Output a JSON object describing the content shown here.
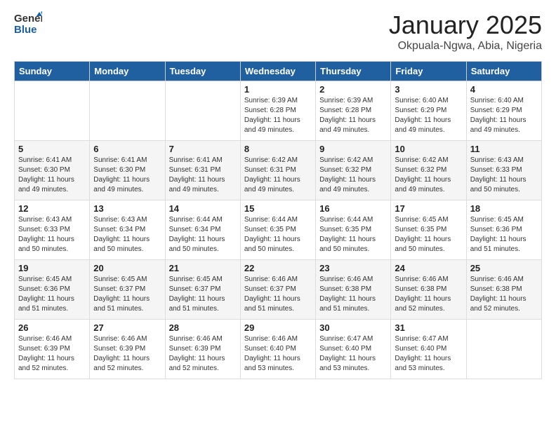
{
  "header": {
    "logo_general": "General",
    "logo_blue": "Blue",
    "month": "January 2025",
    "location": "Okpuala-Ngwa, Abia, Nigeria"
  },
  "weekdays": [
    "Sunday",
    "Monday",
    "Tuesday",
    "Wednesday",
    "Thursday",
    "Friday",
    "Saturday"
  ],
  "weeks": [
    [
      {
        "day": "",
        "info": ""
      },
      {
        "day": "",
        "info": ""
      },
      {
        "day": "",
        "info": ""
      },
      {
        "day": "1",
        "info": "Sunrise: 6:39 AM\nSunset: 6:28 PM\nDaylight: 11 hours and 49 minutes."
      },
      {
        "day": "2",
        "info": "Sunrise: 6:39 AM\nSunset: 6:28 PM\nDaylight: 11 hours and 49 minutes."
      },
      {
        "day": "3",
        "info": "Sunrise: 6:40 AM\nSunset: 6:29 PM\nDaylight: 11 hours and 49 minutes."
      },
      {
        "day": "4",
        "info": "Sunrise: 6:40 AM\nSunset: 6:29 PM\nDaylight: 11 hours and 49 minutes."
      }
    ],
    [
      {
        "day": "5",
        "info": "Sunrise: 6:41 AM\nSunset: 6:30 PM\nDaylight: 11 hours and 49 minutes."
      },
      {
        "day": "6",
        "info": "Sunrise: 6:41 AM\nSunset: 6:30 PM\nDaylight: 11 hours and 49 minutes."
      },
      {
        "day": "7",
        "info": "Sunrise: 6:41 AM\nSunset: 6:31 PM\nDaylight: 11 hours and 49 minutes."
      },
      {
        "day": "8",
        "info": "Sunrise: 6:42 AM\nSunset: 6:31 PM\nDaylight: 11 hours and 49 minutes."
      },
      {
        "day": "9",
        "info": "Sunrise: 6:42 AM\nSunset: 6:32 PM\nDaylight: 11 hours and 49 minutes."
      },
      {
        "day": "10",
        "info": "Sunrise: 6:42 AM\nSunset: 6:32 PM\nDaylight: 11 hours and 49 minutes."
      },
      {
        "day": "11",
        "info": "Sunrise: 6:43 AM\nSunset: 6:33 PM\nDaylight: 11 hours and 50 minutes."
      }
    ],
    [
      {
        "day": "12",
        "info": "Sunrise: 6:43 AM\nSunset: 6:33 PM\nDaylight: 11 hours and 50 minutes."
      },
      {
        "day": "13",
        "info": "Sunrise: 6:43 AM\nSunset: 6:34 PM\nDaylight: 11 hours and 50 minutes."
      },
      {
        "day": "14",
        "info": "Sunrise: 6:44 AM\nSunset: 6:34 PM\nDaylight: 11 hours and 50 minutes."
      },
      {
        "day": "15",
        "info": "Sunrise: 6:44 AM\nSunset: 6:35 PM\nDaylight: 11 hours and 50 minutes."
      },
      {
        "day": "16",
        "info": "Sunrise: 6:44 AM\nSunset: 6:35 PM\nDaylight: 11 hours and 50 minutes."
      },
      {
        "day": "17",
        "info": "Sunrise: 6:45 AM\nSunset: 6:35 PM\nDaylight: 11 hours and 50 minutes."
      },
      {
        "day": "18",
        "info": "Sunrise: 6:45 AM\nSunset: 6:36 PM\nDaylight: 11 hours and 51 minutes."
      }
    ],
    [
      {
        "day": "19",
        "info": "Sunrise: 6:45 AM\nSunset: 6:36 PM\nDaylight: 11 hours and 51 minutes."
      },
      {
        "day": "20",
        "info": "Sunrise: 6:45 AM\nSunset: 6:37 PM\nDaylight: 11 hours and 51 minutes."
      },
      {
        "day": "21",
        "info": "Sunrise: 6:45 AM\nSunset: 6:37 PM\nDaylight: 11 hours and 51 minutes."
      },
      {
        "day": "22",
        "info": "Sunrise: 6:46 AM\nSunset: 6:37 PM\nDaylight: 11 hours and 51 minutes."
      },
      {
        "day": "23",
        "info": "Sunrise: 6:46 AM\nSunset: 6:38 PM\nDaylight: 11 hours and 51 minutes."
      },
      {
        "day": "24",
        "info": "Sunrise: 6:46 AM\nSunset: 6:38 PM\nDaylight: 11 hours and 52 minutes."
      },
      {
        "day": "25",
        "info": "Sunrise: 6:46 AM\nSunset: 6:38 PM\nDaylight: 11 hours and 52 minutes."
      }
    ],
    [
      {
        "day": "26",
        "info": "Sunrise: 6:46 AM\nSunset: 6:39 PM\nDaylight: 11 hours and 52 minutes."
      },
      {
        "day": "27",
        "info": "Sunrise: 6:46 AM\nSunset: 6:39 PM\nDaylight: 11 hours and 52 minutes."
      },
      {
        "day": "28",
        "info": "Sunrise: 6:46 AM\nSunset: 6:39 PM\nDaylight: 11 hours and 52 minutes."
      },
      {
        "day": "29",
        "info": "Sunrise: 6:46 AM\nSunset: 6:40 PM\nDaylight: 11 hours and 53 minutes."
      },
      {
        "day": "30",
        "info": "Sunrise: 6:47 AM\nSunset: 6:40 PM\nDaylight: 11 hours and 53 minutes."
      },
      {
        "day": "31",
        "info": "Sunrise: 6:47 AM\nSunset: 6:40 PM\nDaylight: 11 hours and 53 minutes."
      },
      {
        "day": "",
        "info": ""
      }
    ]
  ]
}
